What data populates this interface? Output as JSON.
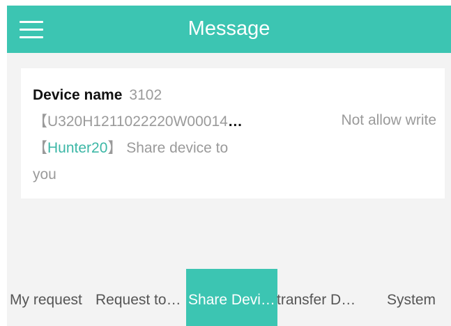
{
  "header": {
    "title": "Message",
    "menu_icon": "hamburger-menu-icon"
  },
  "message": {
    "device_label": "Device name",
    "device_name": "3102",
    "serial": "【U320H1211022220W00014",
    "serial_ellipsis": "…",
    "share_prefix": "【",
    "user": "Hunter20",
    "share_suffix": "】 Share device to",
    "share_tail": "you",
    "status": "Not allow write"
  },
  "tabs": [
    {
      "label": "My request",
      "active": false
    },
    {
      "label": "Request to…",
      "active": false
    },
    {
      "label": "Share Devi…",
      "active": true
    },
    {
      "label": "transfer D…",
      "active": false
    },
    {
      "label": "System",
      "active": false
    }
  ],
  "colors": {
    "accent": "#3cc5b2",
    "link": "#3cb7a6",
    "background": "#f3f3f3",
    "muted_text": "#9a9a9a"
  }
}
